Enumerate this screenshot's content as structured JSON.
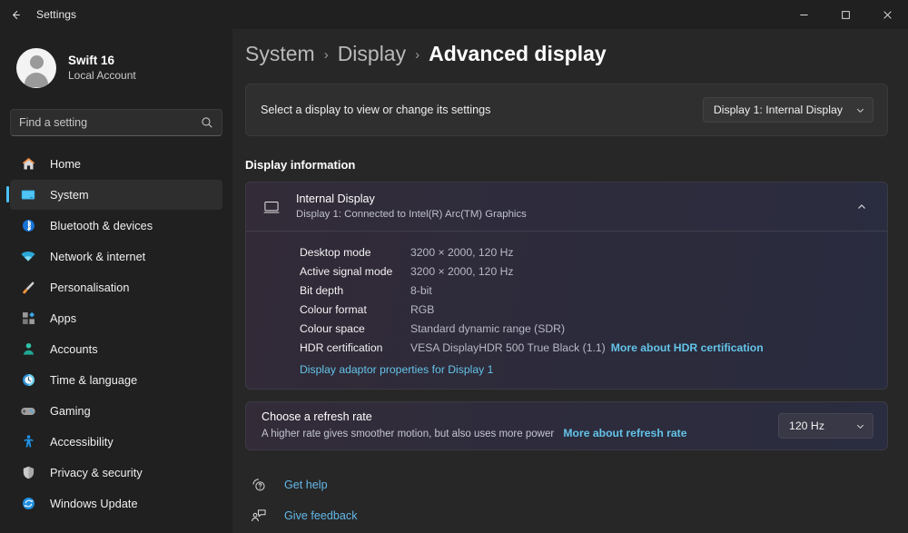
{
  "titlebar": {
    "back_icon": "back-arrow-icon",
    "title": "Settings",
    "minimize_label": "─",
    "maximize_label": "□",
    "close_label": "✕"
  },
  "sidebar": {
    "account": {
      "name": "Swift 16",
      "type": "Local Account",
      "avatar_icon": "user-avatar-icon"
    },
    "search": {
      "placeholder": "Find a setting",
      "value": "",
      "icon": "search-icon"
    },
    "items": [
      {
        "label": "Home",
        "icon": "home-icon",
        "active": false
      },
      {
        "label": "System",
        "icon": "monitor-icon",
        "active": true
      },
      {
        "label": "Bluetooth & devices",
        "icon": "bluetooth-icon",
        "active": false
      },
      {
        "label": "Network & internet",
        "icon": "wifi-icon",
        "active": false
      },
      {
        "label": "Personalisation",
        "icon": "paintbrush-icon",
        "active": false
      },
      {
        "label": "Apps",
        "icon": "apps-icon",
        "active": false
      },
      {
        "label": "Accounts",
        "icon": "person-icon",
        "active": false
      },
      {
        "label": "Time & language",
        "icon": "clock-icon",
        "active": false
      },
      {
        "label": "Gaming",
        "icon": "gamepad-icon",
        "active": false
      },
      {
        "label": "Accessibility",
        "icon": "accessibility-icon",
        "active": false
      },
      {
        "label": "Privacy & security",
        "icon": "shield-icon",
        "active": false
      },
      {
        "label": "Windows Update",
        "icon": "update-icon",
        "active": false
      }
    ]
  },
  "main": {
    "breadcrumb": {
      "level1": "System",
      "level2": "Display",
      "level3": "Advanced display",
      "separator": "›"
    },
    "display_selector": {
      "label": "Select a display to view or change its settings",
      "value": "Display 1: Internal Display",
      "chevron_icon": "chevron-down-icon"
    },
    "display_information": {
      "section_title": "Display information",
      "device_name": "Internal Display",
      "device_sub": "Display 1: Connected to Intel(R) Arc(TM) Graphics",
      "device_icon": "monitor-icon",
      "expand_icon": "chevron-up-icon",
      "rows": [
        {
          "label": "Desktop mode",
          "value": "3200 × 2000, 120 Hz"
        },
        {
          "label": "Active signal mode",
          "value": "3200 × 2000, 120 Hz"
        },
        {
          "label": "Bit depth",
          "value": "8-bit"
        },
        {
          "label": "Colour format",
          "value": "RGB"
        },
        {
          "label": "Colour space",
          "value": "Standard dynamic range (SDR)"
        },
        {
          "label": "HDR certification",
          "value": "VESA DisplayHDR 500 True Black (1.1)",
          "link": "More about HDR certification"
        }
      ],
      "adaptor_link": "Display adaptor properties for Display 1"
    },
    "refresh_rate": {
      "title": "Choose a refresh rate",
      "subtitle": "A higher rate gives smoother motion, but also uses more power",
      "link": "More about refresh rate",
      "value": "120 Hz",
      "chevron_icon": "chevron-down-icon"
    },
    "footer": [
      {
        "label": "Get help",
        "icon": "help-question-icon"
      },
      {
        "label": "Give feedback",
        "icon": "feedback-person-icon"
      }
    ]
  },
  "colors": {
    "accent": "#4cc2ff",
    "link": "#63c3e8",
    "window_bg": "#202020",
    "main_bg": "#272727",
    "card_bg": "#2f2f2f"
  }
}
